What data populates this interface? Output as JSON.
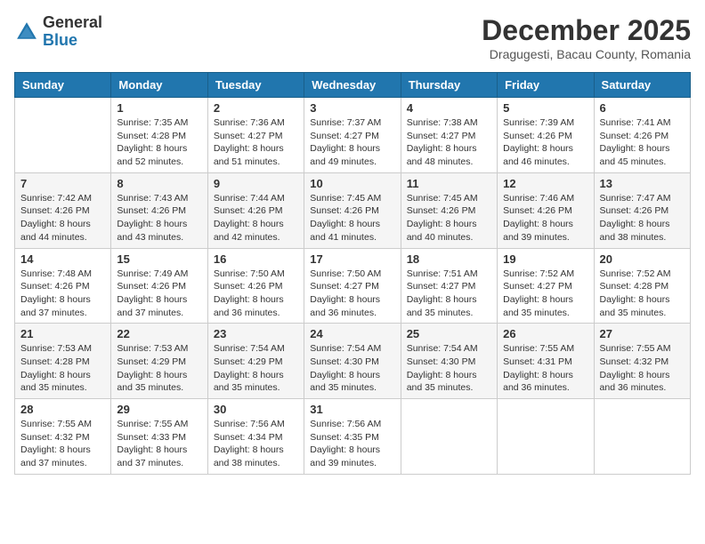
{
  "header": {
    "logo": {
      "general": "General",
      "blue": "Blue"
    },
    "title": "December 2025",
    "subtitle": "Dragugesti, Bacau County, Romania"
  },
  "days_of_week": [
    "Sunday",
    "Monday",
    "Tuesday",
    "Wednesday",
    "Thursday",
    "Friday",
    "Saturday"
  ],
  "weeks": [
    [
      {
        "day": "",
        "info": ""
      },
      {
        "day": "1",
        "info": "Sunrise: 7:35 AM\nSunset: 4:28 PM\nDaylight: 8 hours\nand 52 minutes."
      },
      {
        "day": "2",
        "info": "Sunrise: 7:36 AM\nSunset: 4:27 PM\nDaylight: 8 hours\nand 51 minutes."
      },
      {
        "day": "3",
        "info": "Sunrise: 7:37 AM\nSunset: 4:27 PM\nDaylight: 8 hours\nand 49 minutes."
      },
      {
        "day": "4",
        "info": "Sunrise: 7:38 AM\nSunset: 4:27 PM\nDaylight: 8 hours\nand 48 minutes."
      },
      {
        "day": "5",
        "info": "Sunrise: 7:39 AM\nSunset: 4:26 PM\nDaylight: 8 hours\nand 46 minutes."
      },
      {
        "day": "6",
        "info": "Sunrise: 7:41 AM\nSunset: 4:26 PM\nDaylight: 8 hours\nand 45 minutes."
      }
    ],
    [
      {
        "day": "7",
        "info": "Sunrise: 7:42 AM\nSunset: 4:26 PM\nDaylight: 8 hours\nand 44 minutes."
      },
      {
        "day": "8",
        "info": "Sunrise: 7:43 AM\nSunset: 4:26 PM\nDaylight: 8 hours\nand 43 minutes."
      },
      {
        "day": "9",
        "info": "Sunrise: 7:44 AM\nSunset: 4:26 PM\nDaylight: 8 hours\nand 42 minutes."
      },
      {
        "day": "10",
        "info": "Sunrise: 7:45 AM\nSunset: 4:26 PM\nDaylight: 8 hours\nand 41 minutes."
      },
      {
        "day": "11",
        "info": "Sunrise: 7:45 AM\nSunset: 4:26 PM\nDaylight: 8 hours\nand 40 minutes."
      },
      {
        "day": "12",
        "info": "Sunrise: 7:46 AM\nSunset: 4:26 PM\nDaylight: 8 hours\nand 39 minutes."
      },
      {
        "day": "13",
        "info": "Sunrise: 7:47 AM\nSunset: 4:26 PM\nDaylight: 8 hours\nand 38 minutes."
      }
    ],
    [
      {
        "day": "14",
        "info": "Sunrise: 7:48 AM\nSunset: 4:26 PM\nDaylight: 8 hours\nand 37 minutes."
      },
      {
        "day": "15",
        "info": "Sunrise: 7:49 AM\nSunset: 4:26 PM\nDaylight: 8 hours\nand 37 minutes."
      },
      {
        "day": "16",
        "info": "Sunrise: 7:50 AM\nSunset: 4:26 PM\nDaylight: 8 hours\nand 36 minutes."
      },
      {
        "day": "17",
        "info": "Sunrise: 7:50 AM\nSunset: 4:27 PM\nDaylight: 8 hours\nand 36 minutes."
      },
      {
        "day": "18",
        "info": "Sunrise: 7:51 AM\nSunset: 4:27 PM\nDaylight: 8 hours\nand 35 minutes."
      },
      {
        "day": "19",
        "info": "Sunrise: 7:52 AM\nSunset: 4:27 PM\nDaylight: 8 hours\nand 35 minutes."
      },
      {
        "day": "20",
        "info": "Sunrise: 7:52 AM\nSunset: 4:28 PM\nDaylight: 8 hours\nand 35 minutes."
      }
    ],
    [
      {
        "day": "21",
        "info": "Sunrise: 7:53 AM\nSunset: 4:28 PM\nDaylight: 8 hours\nand 35 minutes."
      },
      {
        "day": "22",
        "info": "Sunrise: 7:53 AM\nSunset: 4:29 PM\nDaylight: 8 hours\nand 35 minutes."
      },
      {
        "day": "23",
        "info": "Sunrise: 7:54 AM\nSunset: 4:29 PM\nDaylight: 8 hours\nand 35 minutes."
      },
      {
        "day": "24",
        "info": "Sunrise: 7:54 AM\nSunset: 4:30 PM\nDaylight: 8 hours\nand 35 minutes."
      },
      {
        "day": "25",
        "info": "Sunrise: 7:54 AM\nSunset: 4:30 PM\nDaylight: 8 hours\nand 35 minutes."
      },
      {
        "day": "26",
        "info": "Sunrise: 7:55 AM\nSunset: 4:31 PM\nDaylight: 8 hours\nand 36 minutes."
      },
      {
        "day": "27",
        "info": "Sunrise: 7:55 AM\nSunset: 4:32 PM\nDaylight: 8 hours\nand 36 minutes."
      }
    ],
    [
      {
        "day": "28",
        "info": "Sunrise: 7:55 AM\nSunset: 4:32 PM\nDaylight: 8 hours\nand 37 minutes."
      },
      {
        "day": "29",
        "info": "Sunrise: 7:55 AM\nSunset: 4:33 PM\nDaylight: 8 hours\nand 37 minutes."
      },
      {
        "day": "30",
        "info": "Sunrise: 7:56 AM\nSunset: 4:34 PM\nDaylight: 8 hours\nand 38 minutes."
      },
      {
        "day": "31",
        "info": "Sunrise: 7:56 AM\nSunset: 4:35 PM\nDaylight: 8 hours\nand 39 minutes."
      },
      {
        "day": "",
        "info": ""
      },
      {
        "day": "",
        "info": ""
      },
      {
        "day": "",
        "info": ""
      }
    ]
  ]
}
